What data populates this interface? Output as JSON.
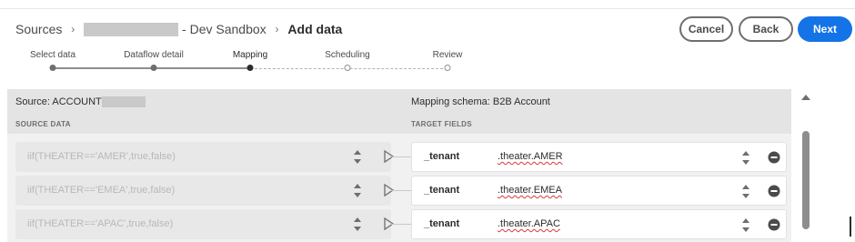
{
  "breadcrumb": {
    "root": "Sources",
    "sandbox_suffix": "- Dev Sandbox",
    "current": "Add data"
  },
  "actions": {
    "cancel": "Cancel",
    "back": "Back",
    "next": "Next"
  },
  "steps": [
    {
      "label": "Select data",
      "state": "done"
    },
    {
      "label": "Dataflow detail",
      "state": "done"
    },
    {
      "label": "Mapping",
      "state": "active"
    },
    {
      "label": "Scheduling",
      "state": "todo"
    },
    {
      "label": "Review",
      "state": "todo"
    }
  ],
  "mapping": {
    "source_title": "Source: ACCOUNT",
    "target_title": "Mapping schema: B2B Account",
    "source_header": "SOURCE DATA",
    "target_header": "TARGET FIELDS",
    "rows": [
      {
        "source": "iif(THEATER=='AMER',true,false)",
        "tenant": "_tenant",
        "target": ".theater.AMER"
      },
      {
        "source": "iif(THEATER=='EMEA',true,false)",
        "tenant": "_tenant",
        "target": ".theater.EMEA"
      },
      {
        "source": "iif(THEATER=='APAC',true,false)",
        "tenant": "_tenant",
        "target": ".theater.APAC"
      }
    ]
  },
  "colors": {
    "accent": "#1473e6",
    "spell_error": "#d7373f"
  },
  "icons": {
    "breadcrumb_separator": "chevron-right-icon",
    "row_stepper": "sort-arrows-icon",
    "row_select": "cursor-pointer-icon",
    "row_remove": "remove-circle-icon",
    "scroll_up": "caret-up-icon"
  }
}
